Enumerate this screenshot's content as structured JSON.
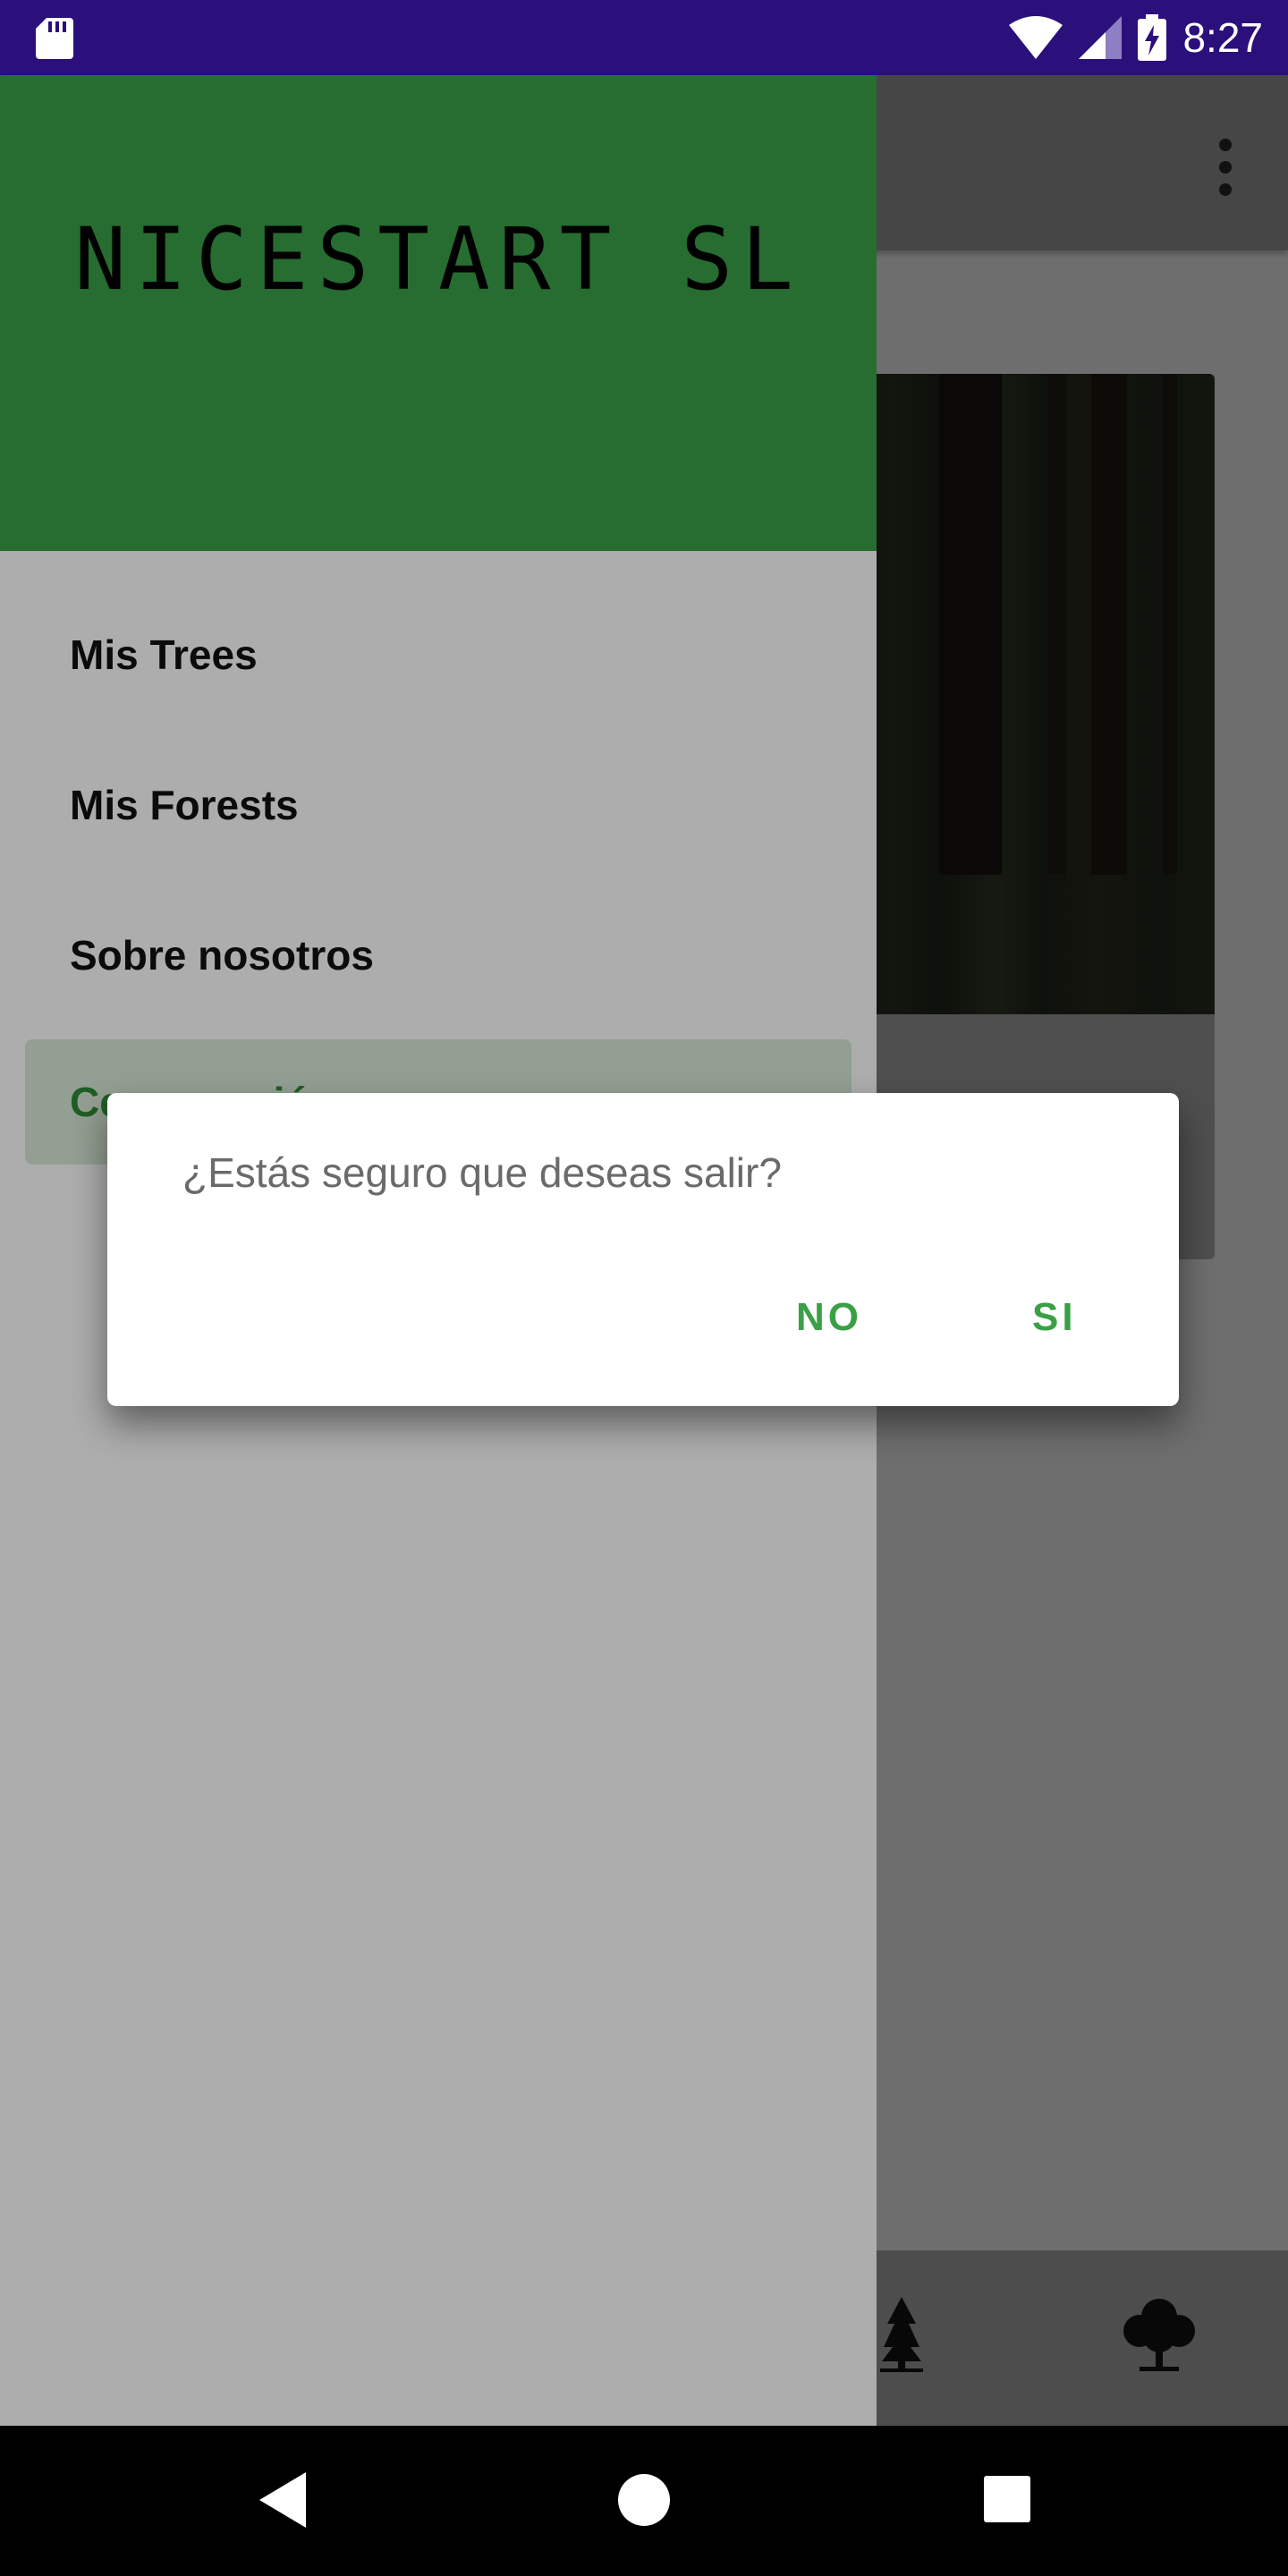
{
  "status_bar": {
    "time": "8:27",
    "icons": [
      "sd-card-icon",
      "wifi-icon",
      "signal-icon",
      "battery-charging-icon"
    ]
  },
  "app": {
    "toolbar": {
      "overflow_icon": "overflow-menu-icon"
    },
    "bottom_nav": {
      "icons": [
        "pine-tree-icon",
        "tree-icon"
      ]
    }
  },
  "drawer": {
    "header_title": "NICESTART SL",
    "header_color": "#3aa047",
    "items": [
      {
        "label": "Mis Trees"
      },
      {
        "label": "Mis Forests"
      },
      {
        "label": "Sobre nosotros"
      },
      {
        "label": "Cerrar sesión",
        "selected": true
      }
    ]
  },
  "dialog": {
    "message": "¿Estás seguro que deseas salir?",
    "negative_label": "NO",
    "positive_label": "SI",
    "accent": "#3aa047"
  },
  "system_nav": {
    "icons": [
      "back-icon",
      "home-icon",
      "recents-icon"
    ]
  }
}
